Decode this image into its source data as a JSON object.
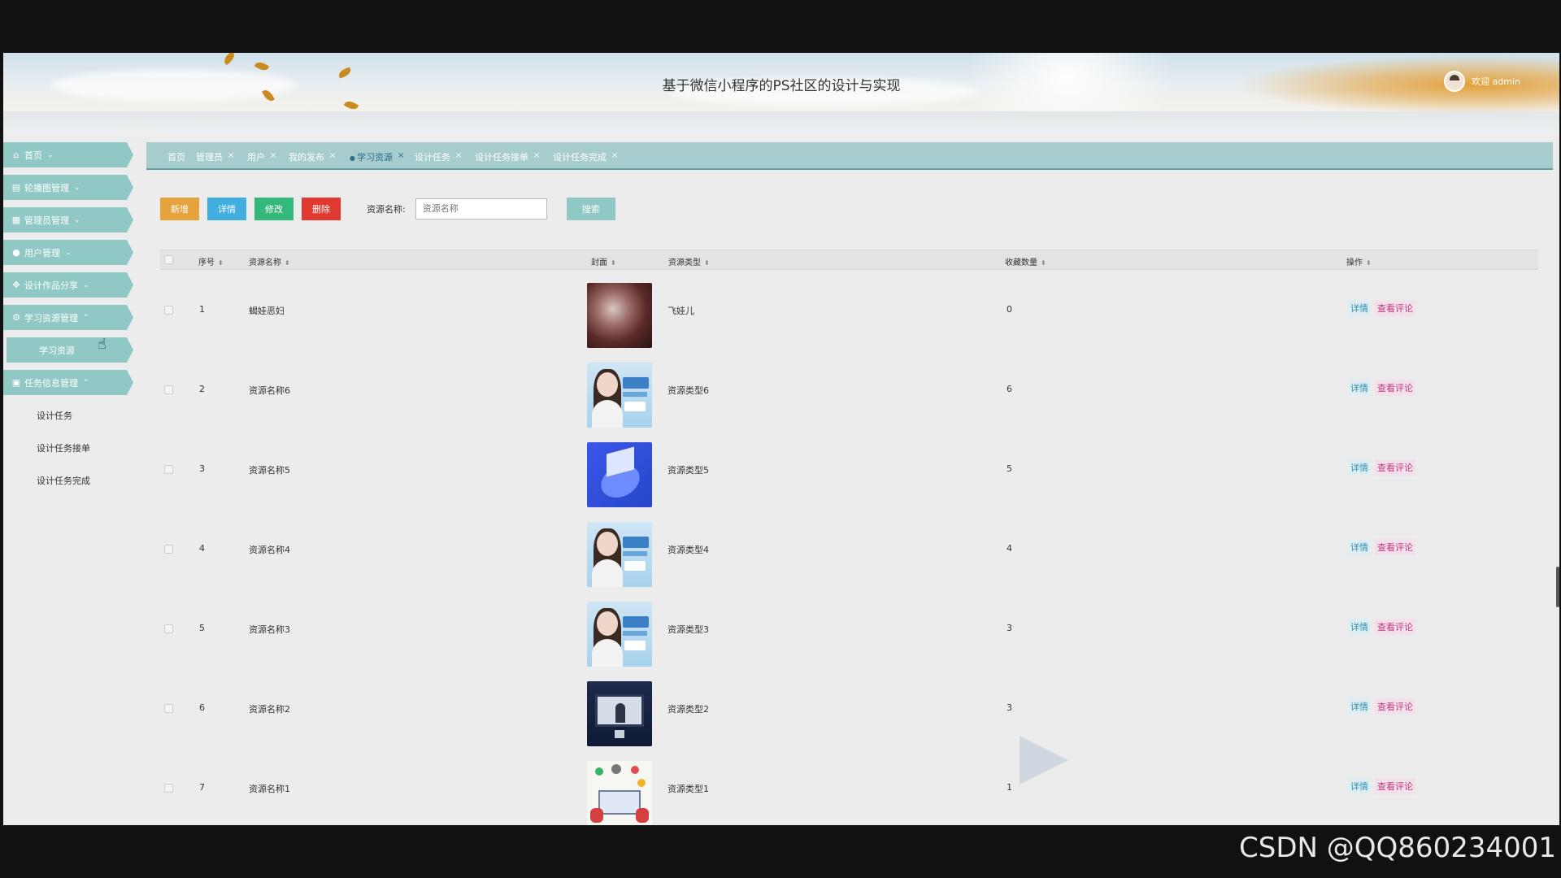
{
  "header": {
    "site_title": "基于微信小程序的PS社区的设计与实现",
    "user_text": "欢迎 admin"
  },
  "sidebar": {
    "items": [
      {
        "label": "首页",
        "icon": "home-icon"
      },
      {
        "label": "轮播图管理",
        "icon": "image-icon"
      },
      {
        "label": "管理员管理",
        "icon": "admin-icon"
      },
      {
        "label": "用户管理",
        "icon": "user-icon"
      },
      {
        "label": "设计作品分享",
        "icon": "grid-icon"
      },
      {
        "label": "学习资源管理",
        "icon": "gear-icon"
      },
      {
        "label": "任务信息管理",
        "icon": "task-icon"
      }
    ],
    "sub_active": "学习资源",
    "sub_items": [
      "设计任务",
      "设计任务接单",
      "设计任务完成"
    ]
  },
  "tabs": [
    "首页",
    "管理员",
    "用户",
    "我的发布",
    "学习资源",
    "设计任务",
    "设计任务接单",
    "设计任务完成"
  ],
  "toolbar": {
    "add": "新增",
    "detail": "详情",
    "edit": "修改",
    "delete": "删除",
    "search_label": "资源名称:",
    "search_placeholder": "资源名称",
    "search_button": "搜索"
  },
  "table": {
    "headers": [
      "序号",
      "资源名称",
      "封面",
      "资源类型",
      "收藏数量",
      "操作"
    ],
    "rows": [
      {
        "no": "1",
        "name": "蝎娃恶妇",
        "type": "飞娃儿",
        "fav": "0",
        "cover": "painting"
      },
      {
        "no": "2",
        "name": "资源名称6",
        "type": "资源类型6",
        "fav": "6",
        "cover": "poster"
      },
      {
        "no": "3",
        "name": "资源名称5",
        "type": "资源类型5",
        "fav": "5",
        "cover": "iso"
      },
      {
        "no": "4",
        "name": "资源名称4",
        "type": "资源类型4",
        "fav": "4",
        "cover": "poster"
      },
      {
        "no": "5",
        "name": "资源名称3",
        "type": "资源类型3",
        "fav": "3",
        "cover": "poster"
      },
      {
        "no": "6",
        "name": "资源名称2",
        "type": "资源类型2",
        "fav": "3",
        "cover": "tv"
      },
      {
        "no": "7",
        "name": "资源名称1",
        "type": "资源类型1",
        "fav": "1",
        "cover": "elearn"
      }
    ],
    "op_detail": "详情",
    "op_comment": "查看评论"
  },
  "watermark_text": "CSDN @QQ860234001",
  "colors": {
    "accent": "#8fc8c4",
    "tabbar": "#a6cccd",
    "add": "#e6a23c",
    "detail": "#41aee0",
    "edit": "#35b97b",
    "delete": "#e0392f"
  }
}
